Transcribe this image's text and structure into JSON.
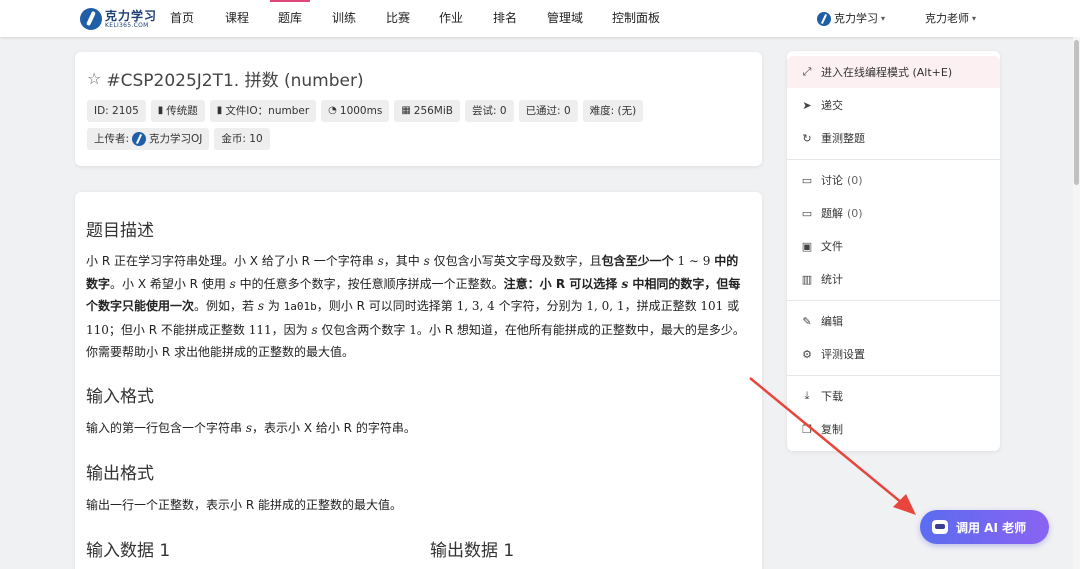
{
  "brand": {
    "name": "克力学习",
    "sub": "KELI365.COM"
  },
  "nav": {
    "items": [
      "首页",
      "课程",
      "题库",
      "训练",
      "比赛",
      "作业",
      "排名",
      "管理域",
      "控制面板"
    ],
    "active_index": 2,
    "org": "克力学习",
    "user": "克力老师"
  },
  "problem": {
    "title": "#CSP2025J2T1. 拼数 (number)",
    "tags": [
      {
        "icon": "",
        "text": "ID: 2105"
      },
      {
        "icon": "bookmark-icon",
        "text": "传统题"
      },
      {
        "icon": "file-icon",
        "text": "文件IO：number"
      },
      {
        "icon": "timer-icon",
        "text": "1000ms"
      },
      {
        "icon": "memory-icon",
        "text": "256MiB"
      },
      {
        "icon": "",
        "text": "尝试: 0"
      },
      {
        "icon": "",
        "text": "已通过: 0"
      },
      {
        "icon": "",
        "text": "难度: (无)"
      }
    ],
    "uploader_label": "上传者:",
    "uploader": "克力学习OJ",
    "coins": "金币: 10"
  },
  "content": {
    "desc_title": "题目描述",
    "desc": {
      "p1": "小 R 正在学习字符串处理。小 X 给了小 R 一个字符串 ",
      "s": "s",
      "p2": "，其中 ",
      "p3": " 仅包含小写英文字母及数字，且",
      "b1": "包含至少一个",
      "range": " 1 ∼ 9 ",
      "b2": "中的数字",
      "p4": "。小 X 希望小 R 使用 ",
      "p5": " 中的任意多个数字，按任意顺序拼成一个正整数。",
      "b3": "注意：小 R 可以选择 ",
      "b4": " 中相同的数字，但每个数字只能使用一次",
      "p6": "。例如，若 ",
      "p7": " 为 ",
      "code": "1a01b",
      "p8": "，则小 R 可以同时选择第 ",
      "idx": "1, 3, 4",
      "p9": " 个字符，分别为 ",
      "vals": "1, 0, 1",
      "p10": "，拼成正整数 ",
      "n1": "101",
      "p11": " 或 ",
      "n2": "110",
      "p12": "；但小 R 不能拼成正整数 ",
      "n3": "111",
      "p13": "，因为 ",
      "p14": " 仅包含两个数字 ",
      "n4": "1",
      "p15": "。小 R 想知道，在他所有能拼成的正整数中，最大的是多少。你需要帮助小 R 求出他能拼成的正整数的最大值。"
    },
    "input_title": "输入格式",
    "input_p1": "输入的第一行包含一个字符串 ",
    "input_s": "s",
    "input_p2": "，表示小 X 给小 R 的字符串。",
    "output_title": "输出格式",
    "output_text": "输出一行一个正整数，表示小 R 能拼成的正整数的最大值。",
    "sample_in": "输入数据 1",
    "sample_out": "输出数据 1"
  },
  "side_menu": [
    {
      "icon": "expand-icon",
      "label": "进入在线编程模式 (Alt+E)",
      "count": ""
    },
    {
      "icon": "send-icon",
      "label": "递交",
      "count": ""
    },
    {
      "icon": "refresh-icon",
      "label": "重测整题",
      "count": ""
    },
    {
      "icon": "comment-icon",
      "label": "讨论",
      "count": "(0)"
    },
    {
      "icon": "comment-icon",
      "label": "题解",
      "count": "(0)"
    },
    {
      "icon": "image-icon",
      "label": "文件",
      "count": ""
    },
    {
      "icon": "bar-chart-icon",
      "label": "统计",
      "count": ""
    },
    {
      "icon": "pencil-icon",
      "label": "编辑",
      "count": ""
    },
    {
      "icon": "gear-icon",
      "label": "评测设置",
      "count": ""
    },
    {
      "icon": "download-icon",
      "label": "下载",
      "count": ""
    },
    {
      "icon": "copy-icon",
      "label": "复制",
      "count": ""
    }
  ],
  "ai_button": {
    "label": "调用 AI 老师"
  },
  "colors": {
    "accent": "#e0487a",
    "ai_start": "#5b6cf0",
    "ai_end": "#8a63f2",
    "arrow": "#e8453c"
  }
}
